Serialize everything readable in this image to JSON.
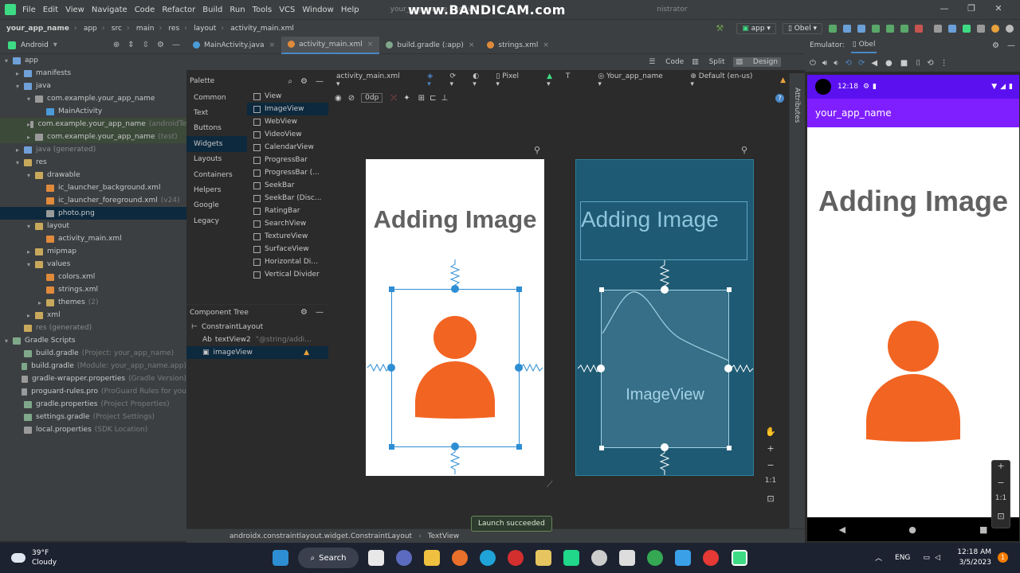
{
  "menubar": {
    "items": [
      "File",
      "Edit",
      "View",
      "Navigate",
      "Code",
      "Refactor",
      "Build",
      "Run",
      "Tools",
      "VCS",
      "Window",
      "Help"
    ],
    "title": "your_app_name - activit",
    "title_tail": "nistrator",
    "watermark": "www.BANDICAM.com"
  },
  "navbar": {
    "crumbs": [
      "your_app_name",
      "app",
      "src",
      "main",
      "res",
      "layout",
      "activity_main.xml"
    ],
    "run_config": "app",
    "device": "Obel"
  },
  "project": {
    "view": "Android",
    "tree": [
      {
        "label": "app",
        "indent": 0,
        "arrow": "▾",
        "color": "#6fa0d8"
      },
      {
        "label": "manifests",
        "indent": 1,
        "arrow": "▸",
        "color": "#6fa0d8"
      },
      {
        "label": "java",
        "indent": 1,
        "arrow": "▾",
        "color": "#6fa0d8"
      },
      {
        "label": "com.example.your_app_name",
        "indent": 2,
        "arrow": "▾",
        "color": "#9a9a9a"
      },
      {
        "label": "MainActivity",
        "indent": 3,
        "arrow": "",
        "color": "#4a9bd8"
      },
      {
        "label": "com.example.your_app_name",
        "sub": "(androidTe",
        "indent": 2,
        "arrow": "▸",
        "color": "#9a9a9a",
        "hl": "g"
      },
      {
        "label": "com.example.your_app_name",
        "sub": "(test)",
        "indent": 2,
        "arrow": "▸",
        "color": "#9a9a9a",
        "hl": "g"
      },
      {
        "label": "java (generated)",
        "indent": 1,
        "arrow": "▸",
        "color": "#6fa0d8",
        "dim": true
      },
      {
        "label": "res",
        "indent": 1,
        "arrow": "▾",
        "color": "#c8a95c"
      },
      {
        "label": "drawable",
        "indent": 2,
        "arrow": "▾",
        "color": "#c8a95c"
      },
      {
        "label": "ic_launcher_background.xml",
        "indent": 3,
        "arrow": "",
        "color": "#e08a3c"
      },
      {
        "label": "ic_launcher_foreground.xml",
        "sub": "(v24)",
        "indent": 3,
        "arrow": "",
        "color": "#e08a3c"
      },
      {
        "label": "photo.png",
        "indent": 3,
        "arrow": "",
        "color": "#9a9a9a",
        "hl": "b"
      },
      {
        "label": "layout",
        "indent": 2,
        "arrow": "▾",
        "color": "#c8a95c"
      },
      {
        "label": "activity_main.xml",
        "indent": 3,
        "arrow": "",
        "color": "#e08a3c"
      },
      {
        "label": "mipmap",
        "indent": 2,
        "arrow": "▸",
        "color": "#c8a95c"
      },
      {
        "label": "values",
        "indent": 2,
        "arrow": "▾",
        "color": "#c8a95c"
      },
      {
        "label": "colors.xml",
        "indent": 3,
        "arrow": "",
        "color": "#e08a3c"
      },
      {
        "label": "strings.xml",
        "indent": 3,
        "arrow": "",
        "color": "#e08a3c"
      },
      {
        "label": "themes",
        "sub": "(2)",
        "indent": 3,
        "arrow": "▸",
        "color": "#c8a95c"
      },
      {
        "label": "xml",
        "indent": 2,
        "arrow": "▸",
        "color": "#c8a95c"
      },
      {
        "label": "res (generated)",
        "indent": 1,
        "arrow": "",
        "color": "#c8a95c",
        "dim": true
      },
      {
        "label": "Gradle Scripts",
        "indent": 0,
        "arrow": "▾",
        "color": "#7fa88a"
      },
      {
        "label": "build.gradle",
        "sub": "(Project: your_app_name)",
        "indent": 1,
        "arrow": "",
        "color": "#7fa88a"
      },
      {
        "label": "build.gradle",
        "sub": "(Module: your_app_name.app)",
        "indent": 1,
        "arrow": "",
        "color": "#7fa88a"
      },
      {
        "label": "gradle-wrapper.properties",
        "sub": "(Gradle Version)",
        "indent": 1,
        "arrow": "",
        "color": "#9a9a9a"
      },
      {
        "label": "proguard-rules.pro",
        "sub": "(ProGuard Rules for you",
        "indent": 1,
        "arrow": "",
        "color": "#9a9a9a"
      },
      {
        "label": "gradle.properties",
        "sub": "(Project Properties)",
        "indent": 1,
        "arrow": "",
        "color": "#7fa88a"
      },
      {
        "label": "settings.gradle",
        "sub": "(Project Settings)",
        "indent": 1,
        "arrow": "",
        "color": "#7fa88a"
      },
      {
        "label": "local.properties",
        "sub": "(SDK Location)",
        "indent": 1,
        "arrow": "",
        "color": "#9a9a9a"
      }
    ]
  },
  "editor_tabs": [
    {
      "label": "MainActivity.java",
      "color": "#4a9bd8",
      "active": false
    },
    {
      "label": "activity_main.xml",
      "color": "#e08a3c",
      "active": true
    },
    {
      "label": "build.gradle (:app)",
      "color": "#7fa88a",
      "active": false
    },
    {
      "label": "strings.xml",
      "color": "#e08a3c",
      "active": false
    }
  ],
  "modes": {
    "code": "Code",
    "split": "Split",
    "design": "Design"
  },
  "palette": {
    "title": "Palette",
    "categories": [
      "Common",
      "Text",
      "Buttons",
      "Widgets",
      "Layouts",
      "Containers",
      "Helpers",
      "Google",
      "Legacy"
    ],
    "selected_category": "Widgets",
    "items": [
      "View",
      "ImageView",
      "WebView",
      "VideoView",
      "CalendarView",
      "ProgressBar",
      "ProgressBar (...",
      "SeekBar",
      "SeekBar (Disc...",
      "RatingBar",
      "SearchView",
      "TextureView",
      "SurfaceView",
      "Horizontal Di...",
      "Vertical Divider"
    ],
    "selected_item": "ImageView"
  },
  "component_tree": {
    "title": "Component Tree",
    "rows": [
      {
        "label": "ConstraintLayout",
        "prefix": "",
        "sub": "",
        "indent": 0
      },
      {
        "label": "textView2",
        "prefix": "Ab",
        "sub": "\"@string/addi...",
        "indent": 1
      },
      {
        "label": "imageView",
        "prefix": "",
        "sub": "",
        "indent": 1,
        "selected": true,
        "warning": true
      }
    ]
  },
  "design_toolbar": {
    "file": "activity_main.xml",
    "device": "Pixel",
    "api": "T",
    "theme": "Your_app_name",
    "locale": "Default (en-us)",
    "margin": "0dp"
  },
  "design": {
    "title_text": "Adding Image",
    "blueprint_label": "ImageView",
    "person_color": "#f26422"
  },
  "attributes_label": "Attributes",
  "emulator": {
    "tab": "Emulator:",
    "device": "Obel",
    "time": "12:18",
    "app_title": "your_app_name",
    "title_text": "Adding Image"
  },
  "statusbar": {
    "path": "androidx.constraintlayout.widget.ConstraintLayout",
    "leaf": "TextView",
    "toast": "Launch succeeded"
  },
  "zoom": {
    "plus": "+",
    "minus": "−",
    "one_to_one": "1:1"
  },
  "taskbar": {
    "temp": "39°F",
    "condition": "Cloudy",
    "search": "Search",
    "lang": "ENG",
    "time": "12:18 AM",
    "date": "3/5/2023"
  }
}
